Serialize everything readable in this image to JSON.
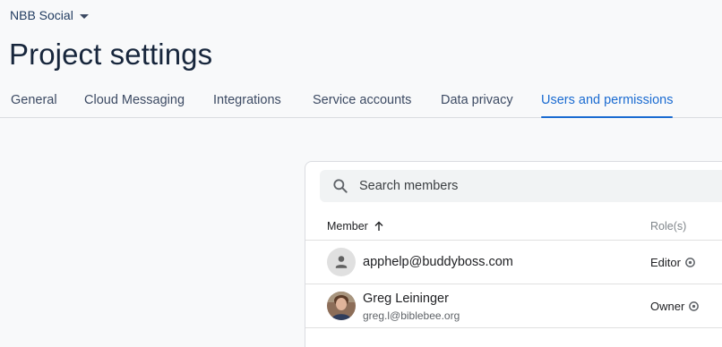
{
  "project": {
    "name": "NBB Social"
  },
  "page": {
    "title": "Project settings"
  },
  "tabs": [
    {
      "label": "General",
      "active": false
    },
    {
      "label": "Cloud Messaging",
      "active": false
    },
    {
      "label": "Integrations",
      "active": false
    },
    {
      "label": "Service accounts",
      "active": false
    },
    {
      "label": "Data privacy",
      "active": false
    },
    {
      "label": "Users and permissions",
      "active": true
    }
  ],
  "search": {
    "placeholder": "Search members",
    "value": ""
  },
  "table": {
    "columns": {
      "member": "Member",
      "roles": "Role(s)"
    },
    "sort": "ascending",
    "rows": [
      {
        "email": "apphelp@buddyboss.com",
        "name": "",
        "role": "Editor",
        "avatar": "person-icon"
      },
      {
        "name": "Greg Leininger",
        "email": "greg.l@biblebee.org",
        "role": "Owner",
        "avatar": "photo"
      }
    ]
  },
  "colors": {
    "accent": "#1a6bd1",
    "title": "#17263c",
    "tab_text": "#3c4a63"
  }
}
